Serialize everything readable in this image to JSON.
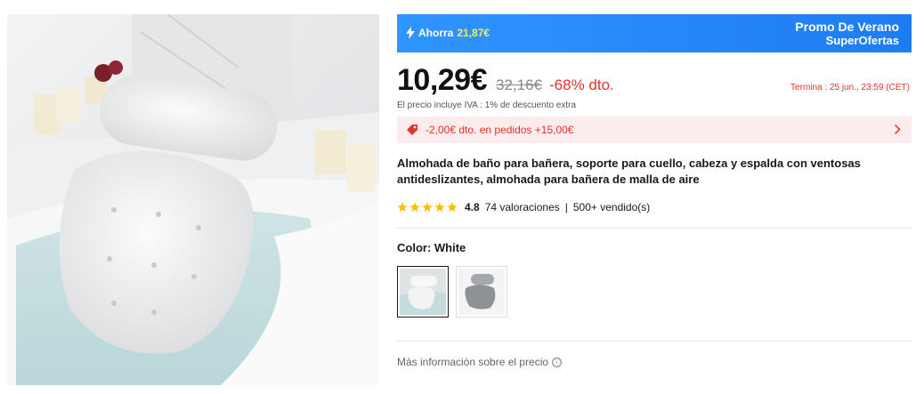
{
  "promo_banner": {
    "save_label": "Ahorra",
    "save_amount": "21,87€",
    "title": "Promo De Verano",
    "subtitle": "SuperOfertas",
    "icon": "lightning-icon",
    "background_color": "#2f95ff"
  },
  "price": {
    "current": "10,29€",
    "original": "32,16€",
    "discount": "-68% dto.",
    "ends_label": "Termina :  25 jun., 23:59 (CET)",
    "tax_note": "El precio incluye IVA : 1% de descuento extra",
    "accent_color": "#e0342b"
  },
  "coupon": {
    "icon": "tag-icon",
    "text": "-2,00€ dto. en pedidos +15,00€"
  },
  "product": {
    "title": "Almohada de baño para bañera, soporte para cuello, cabeza y espalda con ventosas antideslizantes, almohada para bañera de malla de aire",
    "rating": "4.8",
    "rating_count": "74 valoraciones",
    "separator": "|",
    "sold": "500+ vendido(s)",
    "stars": 5
  },
  "color": {
    "label": "Color: White",
    "options": [
      "White",
      "Grey"
    ],
    "selected": "White"
  },
  "footer": {
    "price_info": "Más información sobre el precio",
    "info_icon": "ⓘ"
  }
}
